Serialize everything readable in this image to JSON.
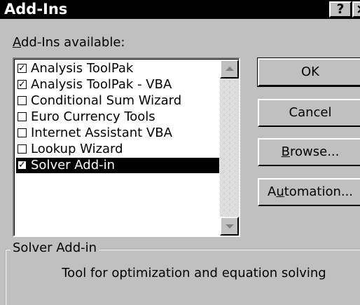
{
  "window": {
    "title": "Add-Ins",
    "help_button": "?",
    "close_button": "×"
  },
  "list": {
    "label_access_key": "A",
    "label_rest": "dd-Ins available:",
    "items": [
      {
        "label": "Analysis ToolPak",
        "checked": true,
        "selected": false
      },
      {
        "label": "Analysis ToolPak - VBA",
        "checked": true,
        "selected": false
      },
      {
        "label": "Conditional Sum Wizard",
        "checked": false,
        "selected": false
      },
      {
        "label": "Euro Currency Tools",
        "checked": false,
        "selected": false
      },
      {
        "label": "Internet Assistant VBA",
        "checked": false,
        "selected": false
      },
      {
        "label": "Lookup Wizard",
        "checked": false,
        "selected": false
      },
      {
        "label": "Solver Add-in",
        "checked": true,
        "selected": true
      }
    ]
  },
  "buttons": {
    "ok": "OK",
    "cancel": "Cancel",
    "browse_key": "B",
    "browse_rest": "rowse...",
    "automation_pre": "A",
    "automation_key": "u",
    "automation_rest": "tomation..."
  },
  "description": {
    "group_title": "Solver Add-in",
    "text": "Tool for optimization and equation solving"
  },
  "check_glyph": "✓"
}
